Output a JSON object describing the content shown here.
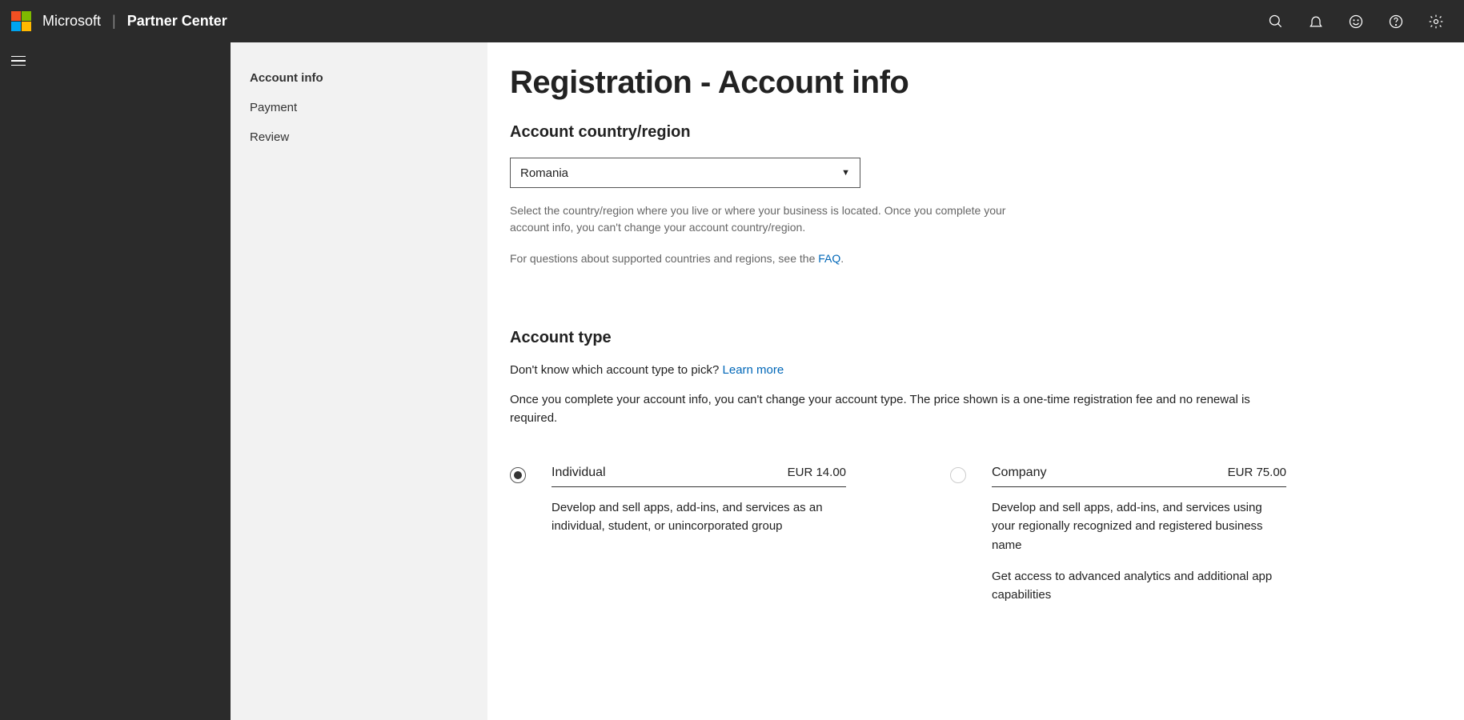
{
  "header": {
    "brand": "Microsoft",
    "product": "Partner Center"
  },
  "sidebar": {
    "items": [
      {
        "label": "Account info",
        "active": true
      },
      {
        "label": "Payment",
        "active": false
      },
      {
        "label": "Review",
        "active": false
      }
    ]
  },
  "page": {
    "title": "Registration - Account info",
    "country_section_title": "Account country/region",
    "country_value": "Romania",
    "country_help": "Select the country/region where you live or where your business is located. Once you complete your account info, you can't change your account country/region.",
    "faq_prefix": "For questions about supported countries and regions, see the ",
    "faq_link": "FAQ",
    "type_section_title": "Account type",
    "type_prompt": "Don't know which account type to pick? ",
    "learn_more": "Learn more",
    "type_desc": "Once you complete your account info, you can't change your account type. The price shown is a one-time registration fee and no renewal is required.",
    "options": [
      {
        "name": "Individual",
        "price": "EUR 14.00",
        "selected": true,
        "descs": [
          "Develop and sell apps, add-ins, and services as an individual, student, or unincorporated group"
        ]
      },
      {
        "name": "Company",
        "price": "EUR 75.00",
        "selected": false,
        "descs": [
          "Develop and sell apps, add-ins, and services using your regionally recognized and registered business name",
          "Get access to advanced analytics and additional app capabilities"
        ]
      }
    ]
  }
}
